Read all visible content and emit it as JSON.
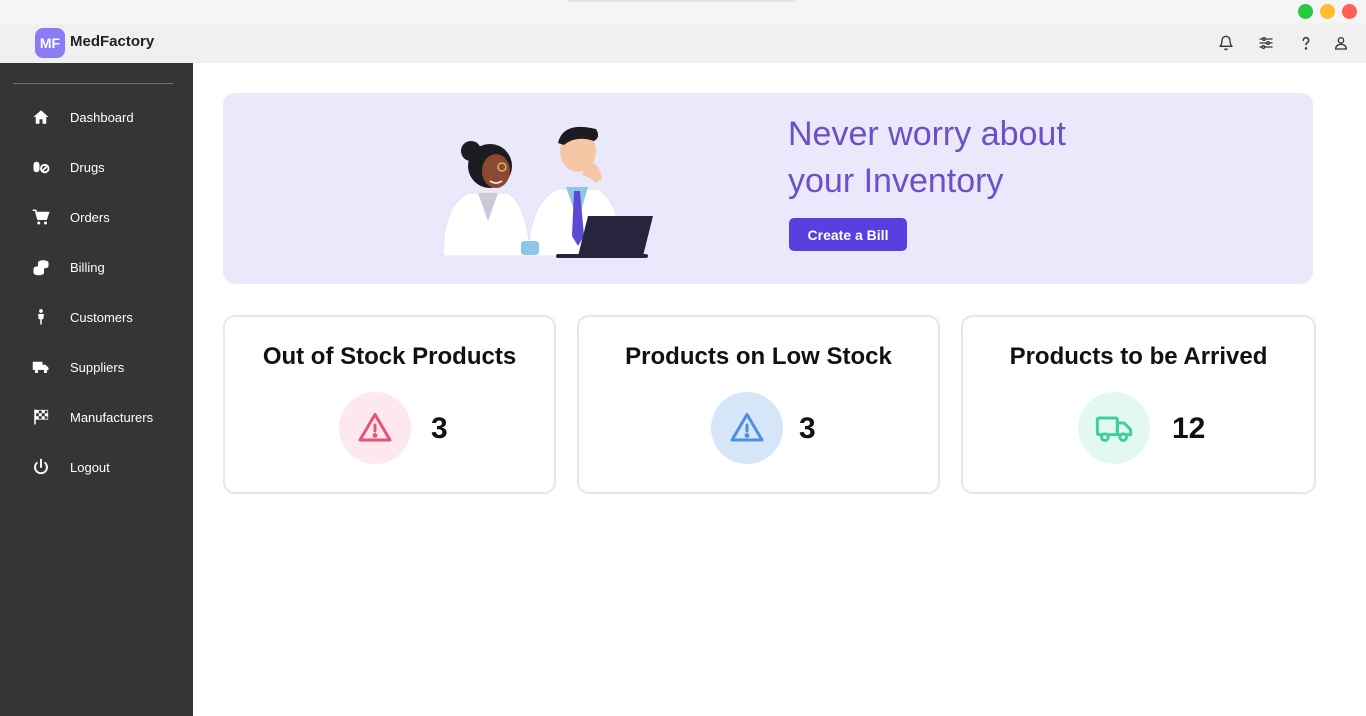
{
  "app": {
    "logo_text": "MF",
    "name": "MedFactory"
  },
  "window_controls": [
    {
      "name": "maximize",
      "color": "#28c840"
    },
    {
      "name": "minimize",
      "color": "#febc2e"
    },
    {
      "name": "close",
      "color": "#ff5f57"
    }
  ],
  "top_icons": [
    "bell-icon",
    "sliders-icon",
    "help-icon",
    "user-icon"
  ],
  "sidebar": {
    "items": [
      {
        "label": "Dashboard",
        "icon": "home-icon"
      },
      {
        "label": "Drugs",
        "icon": "pills-icon"
      },
      {
        "label": "Orders",
        "icon": "cart-icon"
      },
      {
        "label": "Billing",
        "icon": "coins-icon"
      },
      {
        "label": "Customers",
        "icon": "customer-icon"
      },
      {
        "label": "Suppliers",
        "icon": "truck-icon"
      },
      {
        "label": "Manufacturers",
        "icon": "flag-icon"
      },
      {
        "label": "Logout",
        "icon": "power-icon"
      }
    ]
  },
  "banner": {
    "line1": "Never worry about",
    "line2": "your Inventory",
    "button": "Create a Bill"
  },
  "cards": [
    {
      "title": "Out of Stock Products",
      "value": "3",
      "icon": "warning-icon",
      "color": "#e8517a",
      "bg": "#fde8ee"
    },
    {
      "title": "Products on Low Stock",
      "value": "3",
      "icon": "warning-icon",
      "color": "#4a90e2",
      "bg": "#d6e6f9"
    },
    {
      "title": "Products to be Arrived",
      "value": "12",
      "icon": "truck-icon",
      "color": "#3fcf9a",
      "bg": "#e3f8f0"
    }
  ],
  "colors": {
    "sidebar": "#353437",
    "accent": "#5a3fe0",
    "banner_bg": "#eae8fb",
    "headline": "#6d4fc8"
  }
}
